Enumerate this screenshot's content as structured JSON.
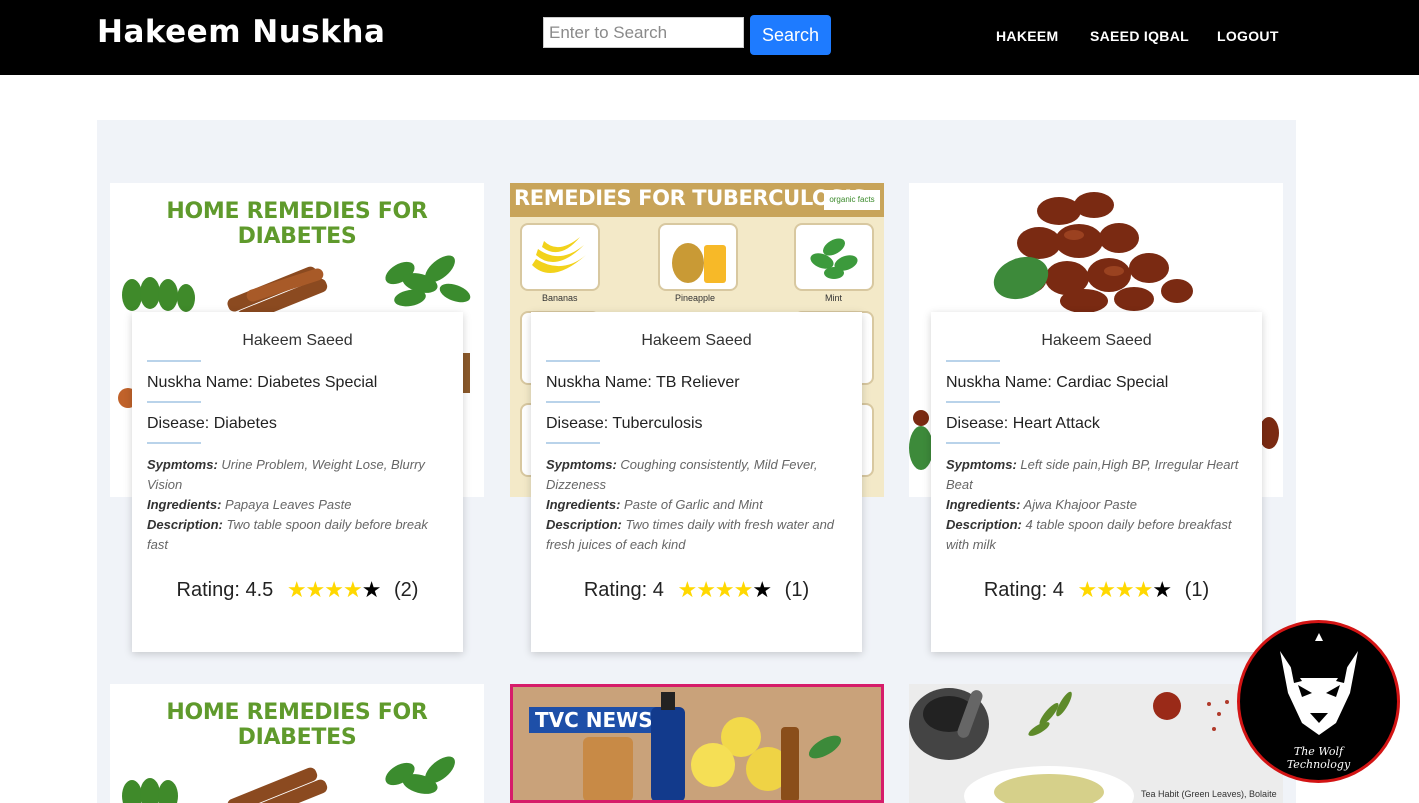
{
  "header": {
    "brand": "Hakeem Nuskha",
    "search_placeholder": "Enter to Search",
    "search_button": "Search",
    "nav_links": [
      "HAKEEM",
      "SAEED IQBAL",
      "LOGOUT"
    ]
  },
  "image_titles": {
    "diabetes": "HOME REMEDIES FOR DIABETES",
    "tuberculosis": "REMEDIES FOR TUBERCULOSIS",
    "tb_fruits": [
      "Bananas",
      "Pineapple",
      "Mint"
    ],
    "news": "TVC NEWS",
    "bottom_caption": "Tea Habit (Green Leaves), Bolaite"
  },
  "cards": [
    {
      "hakeem": "Hakeem Saeed",
      "name_label": "Nuskha Name:",
      "name": "Diabetes Special",
      "disease_label": "Disease:",
      "disease": "Diabetes",
      "symptoms_label": "Sypmtoms:",
      "symptoms": "Urine Problem, Weight Lose, Blurry Vision",
      "ingredients_label": "Ingredients:",
      "ingredients": "Papaya Leaves Paste",
      "description_label": "Description:",
      "description": "Two table spoon daily before break fast",
      "rating_label": "Rating:",
      "rating": "4.5",
      "rating_value": 4.5,
      "count": "(2)"
    },
    {
      "hakeem": "Hakeem Saeed",
      "name_label": "Nuskha Name:",
      "name": "TB Reliever",
      "disease_label": "Disease:",
      "disease": "Tuberculosis",
      "symptoms_label": "Sypmtoms:",
      "symptoms": "Coughing consistently, Mild Fever, Dizzeness",
      "ingredients_label": "Ingredients:",
      "ingredients": "Paste of Garlic and Mint",
      "description_label": "Description:",
      "description": "Two times daily with fresh water and fresh juices of each kind",
      "rating_label": "Rating:",
      "rating": "4",
      "rating_value": 4,
      "count": "(1)"
    },
    {
      "hakeem": "Hakeem Saeed",
      "name_label": "Nuskha Name:",
      "name": "Cardiac Special",
      "disease_label": "Disease:",
      "disease": "Heart Attack",
      "symptoms_label": "Sypmtoms:",
      "symptoms": "Left side pain,High BP, Irregular Heart Beat",
      "ingredients_label": "Ingredients:",
      "ingredients": "Ajwa Khajoor Paste",
      "description_label": "Description:",
      "description": "4 table spoon daily before breakfast with milk",
      "rating_label": "Rating:",
      "rating": "4",
      "rating_value": 4,
      "count": "(1)"
    }
  ],
  "watermark": {
    "line1": "The Wolf",
    "line2": "Technology"
  },
  "colors": {
    "navbar": "#000000",
    "search_button": "#1e7bff",
    "panel": "#f0f3f8",
    "star_filled": "#ffd800",
    "title_green": "#5f9a2c"
  }
}
